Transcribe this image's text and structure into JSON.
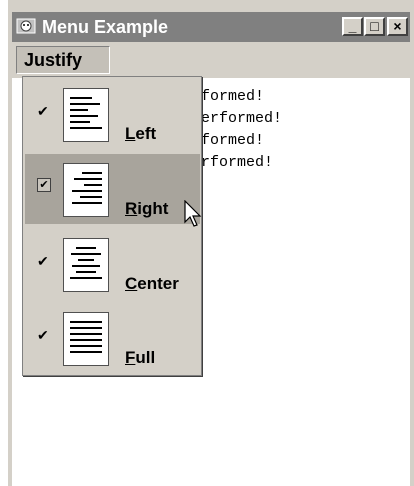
{
  "window": {
    "title": "Menu Example",
    "controls": {
      "minimize": "_",
      "maximize": "□",
      "close": "×"
    }
  },
  "menubar": {
    "justify_label": "Justify"
  },
  "log_lines": [
    "rformed!",
    " performed!",
    "rformed!",
    "erformed!"
  ],
  "menu_items": [
    {
      "label": "Left",
      "mnemonic": "L",
      "rest": "eft",
      "checked": true,
      "icon": "align-left-icon"
    },
    {
      "label": "Right",
      "mnemonic": "R",
      "rest": "ight",
      "checked": true,
      "icon": "align-right-icon",
      "highlighted": true
    },
    {
      "label": "Center",
      "mnemonic": "C",
      "rest": "enter",
      "checked": true,
      "icon": "align-center-icon"
    },
    {
      "label": "Full",
      "mnemonic": "F",
      "rest": "ull",
      "checked": true,
      "icon": "align-justify-icon"
    }
  ]
}
